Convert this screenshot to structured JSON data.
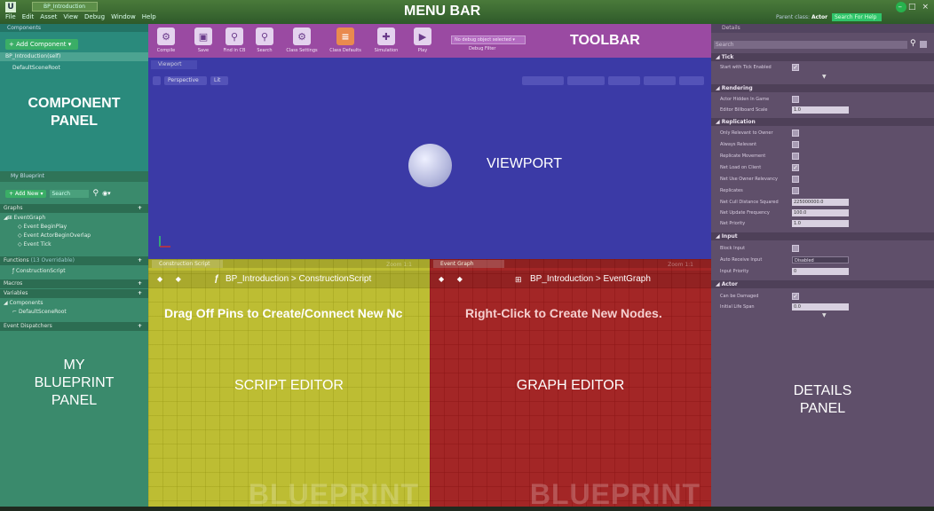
{
  "overlays": {
    "menu_bar": "MENU BAR",
    "toolbar": "TOOLBAR",
    "component_panel": "COMPONENT\nPANEL",
    "viewport": "VIEWPORT",
    "my_blueprint_panel": "MY\nBLUEPRINT\nPANEL",
    "script_editor": "SCRIPT EDITOR",
    "graph_editor": "GRAPH EDITOR",
    "details_panel": "DETAILS\nPANEL"
  },
  "menubar": {
    "logo": "U",
    "doc_tab": "BP_Introduction",
    "items": [
      "File",
      "Edit",
      "Asset",
      "View",
      "Debug",
      "Window",
      "Help"
    ],
    "parent_label": "Parent class:",
    "parent_value": "Actor",
    "search_placeholder": "Search For Help",
    "window_buttons": [
      "–",
      "□",
      "×"
    ]
  },
  "components": {
    "tab": "Components",
    "add_button": "+ Add Component ▾",
    "items": [
      "BP_Introduction(self)",
      "DefaultSceneRoot"
    ]
  },
  "my_blueprint": {
    "tab": "My Blueprint",
    "add_new": "+ Add New ▾",
    "search_placeholder": "Search",
    "graphs_label": "Graphs",
    "event_graph": "EventGraph",
    "events": [
      "Event BeginPlay",
      "Event ActorBeginOverlap",
      "Event Tick"
    ],
    "functions_label": "Functions",
    "functions_note": "(13 Overridable)",
    "construction_script": "ConstructionScript",
    "macros_label": "Macros",
    "variables_label": "Variables",
    "components_label": "Components",
    "default_scene_root": "DefaultSceneRoot",
    "event_dispatchers_label": "Event Dispatchers"
  },
  "toolbar": {
    "buttons": [
      {
        "label": "Compile",
        "icon": "compile-icon",
        "glyph": "⚙"
      },
      {
        "label": "Save",
        "icon": "save-icon",
        "glyph": "▣"
      },
      {
        "label": "Find in CB",
        "icon": "find-icon",
        "glyph": "⚲"
      },
      {
        "label": "Search",
        "icon": "search-icon",
        "glyph": "⚲"
      },
      {
        "label": "Class Settings",
        "icon": "class-settings-icon",
        "glyph": "⚙"
      },
      {
        "label": "Class Defaults",
        "icon": "class-defaults-icon",
        "glyph": "≡"
      },
      {
        "label": "Simulation",
        "icon": "simulation-icon",
        "glyph": "✚"
      },
      {
        "label": "Play",
        "icon": "play-icon",
        "glyph": "▶"
      }
    ],
    "debug_dropdown": "No debug object selected ▾",
    "debug_filter": "Debug Filter"
  },
  "viewport": {
    "tab": "Viewport",
    "perspective": "Perspective",
    "lit": "Lit"
  },
  "script_editor": {
    "tab": "Construction Script",
    "breadcrumb_fn": "ƒ",
    "breadcrumb": "BP_Introduction > ConstructionScript",
    "zoom": "Zoom 1:1",
    "hint": "Drag Off Pins to Create/Connect New Nc",
    "watermark": "BLUEPRINT"
  },
  "graph_editor": {
    "tab": "Event Graph",
    "breadcrumb": "BP_Introduction > EventGraph",
    "zoom": "Zoom 1:1",
    "hint": "Right-Click to Create New Nodes.",
    "watermark": "BLUEPRINT"
  },
  "details": {
    "tab": "Details",
    "search_placeholder": "Search",
    "categories": {
      "tick": "Tick",
      "rendering": "Rendering",
      "replication": "Replication",
      "input": "Input",
      "actor": "Actor"
    },
    "props": {
      "start_with_tick": "Start with Tick Enabled",
      "hidden_in_game": "Actor Hidden In Game",
      "billboard_scale": "Editor Billboard Scale",
      "billboard_value": "1.0",
      "only_relevant": "Only Relevant to Owner",
      "always_relevant": "Always Relevant",
      "replicate_movement": "Replicate Movement",
      "net_load": "Net Load on Client",
      "net_use_owner": "Net Use Owner Relevancy",
      "replicates": "Replicates",
      "cull_distance": "Net Cull Distance Squared",
      "cull_value": "225000000.0",
      "update_freq": "Net Update Frequency",
      "update_value": "100.0",
      "net_priority": "Net Priority",
      "priority_value": "1.0",
      "block_input": "Block Input",
      "auto_receive": "Auto Receive Input",
      "auto_receive_value": "Disabled",
      "input_priority": "Input Priority",
      "input_priority_value": "0",
      "can_be_damaged": "Can be Damaged",
      "initial_life_span": "Initial Life Span",
      "life_span_value": "0.0"
    }
  }
}
